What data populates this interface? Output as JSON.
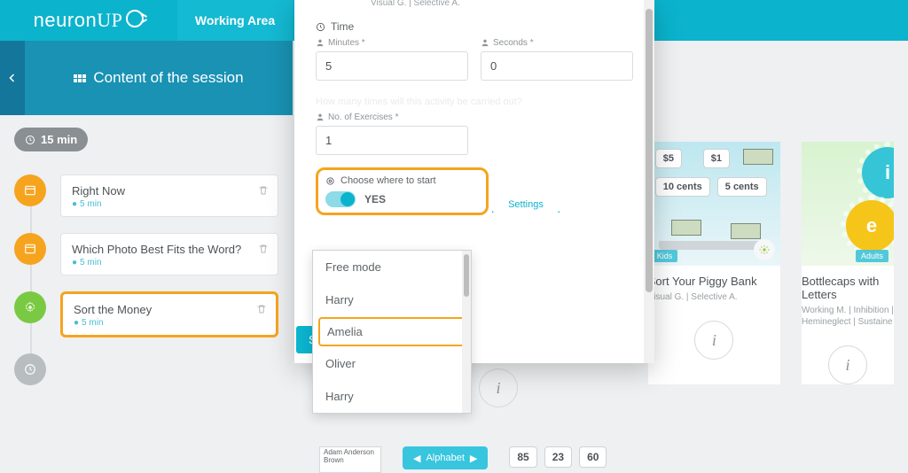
{
  "brand": "neuron",
  "top_nav": {
    "working_area": "Working Area"
  },
  "session": {
    "title": "Content of the session",
    "total_duration": "15 min",
    "items": [
      {
        "title": "Right Now",
        "time": "5 min"
      },
      {
        "title": "Which Photo Best Fits the Word?",
        "time": "5 min"
      },
      {
        "title": "Sort the Money",
        "time": "5 min"
      }
    ]
  },
  "panel": {
    "meta_line": "Visual G. | Selective A.",
    "time_label": "Time",
    "minutes_label": "Minutes *",
    "seconds_label": "Seconds *",
    "minutes": "5",
    "seconds": "0",
    "question": "How many times will this activity be carried out?",
    "exercises_label": "No. of Exercises *",
    "exercises": "1",
    "choose_label": "Choose where to start",
    "toggle_value": "YES",
    "settings_tab": "Settings",
    "save_label": "S"
  },
  "dropdown": {
    "options": [
      "Free mode",
      "Harry",
      "Amelia",
      "Oliver",
      "Harry"
    ],
    "highlight_index": 2
  },
  "gallery": [
    {
      "title": "Sort Your Piggy Bank",
      "tags": "Visual G. | Selective A.",
      "badge": "Kids",
      "pills": [
        "$5",
        "$1",
        "10 cents",
        "5 cents"
      ]
    },
    {
      "title": "Bottlecaps with Letters",
      "tags": "Working M. | Inhibition | Hemineglect | Sustaine",
      "badge": "Adults",
      "caps": [
        "i",
        "e"
      ]
    }
  ],
  "bottom": {
    "names": "Adam\nAnderson\nBrown",
    "alpha_label": "Alphabet",
    "numbers": [
      "85",
      "23",
      "60"
    ]
  }
}
